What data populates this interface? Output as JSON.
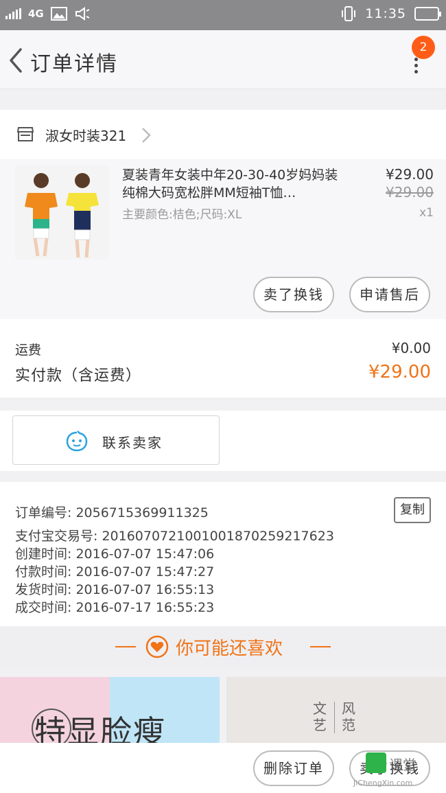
{
  "status_bar": {
    "network": "4G",
    "time": "11:35"
  },
  "header": {
    "title": "订单详情",
    "badge_count": "2"
  },
  "shop": {
    "name": "淑女时装321"
  },
  "product": {
    "name": "夏装青年女装中年20-30-40岁妈妈装纯棉大码宽松胖MM短袖T恤…",
    "attributes": "主要颜色:桔色;尺码:XL",
    "price": "¥29.00",
    "original_price": "¥29.00",
    "quantity": "x1"
  },
  "item_actions": {
    "exchange_label": "卖了换钱",
    "aftersale_label": "申请售后"
  },
  "fees": {
    "shipping_label": "运费",
    "shipping_value": "¥0.00",
    "paid_label": "实付款（含运费）",
    "paid_value": "¥29.00"
  },
  "contact": {
    "label": "联系卖家"
  },
  "order_info": {
    "order_no": "订单编号: 2056715369911325",
    "alipay_no": "支付宝交易号: 2016070721001001870259217623",
    "created": "创建时间: 2016-07-07 15:47:06",
    "paid": "付款时间: 2016-07-07 15:47:27",
    "shipped": "发货时间: 2016-07-07 16:55:13",
    "completed": "成交时间: 2016-07-17 16:55:23",
    "copy_label": "复制"
  },
  "recommend": {
    "title": "你可能还喜欢",
    "products": [
      {
        "text": "特显脸瘦"
      },
      {
        "text_col1": "文艺",
        "text_col2": "风范"
      }
    ]
  },
  "bottom_bar": {
    "delete_label": "删除订单",
    "exchange_label": "卖了换钱"
  },
  "watermark": {
    "text": "课堂",
    "url": "JiChengXin.com"
  },
  "colors": {
    "accent": "#f07317",
    "badge": "#ff5d17",
    "status_bar": "#8a8a8d"
  }
}
